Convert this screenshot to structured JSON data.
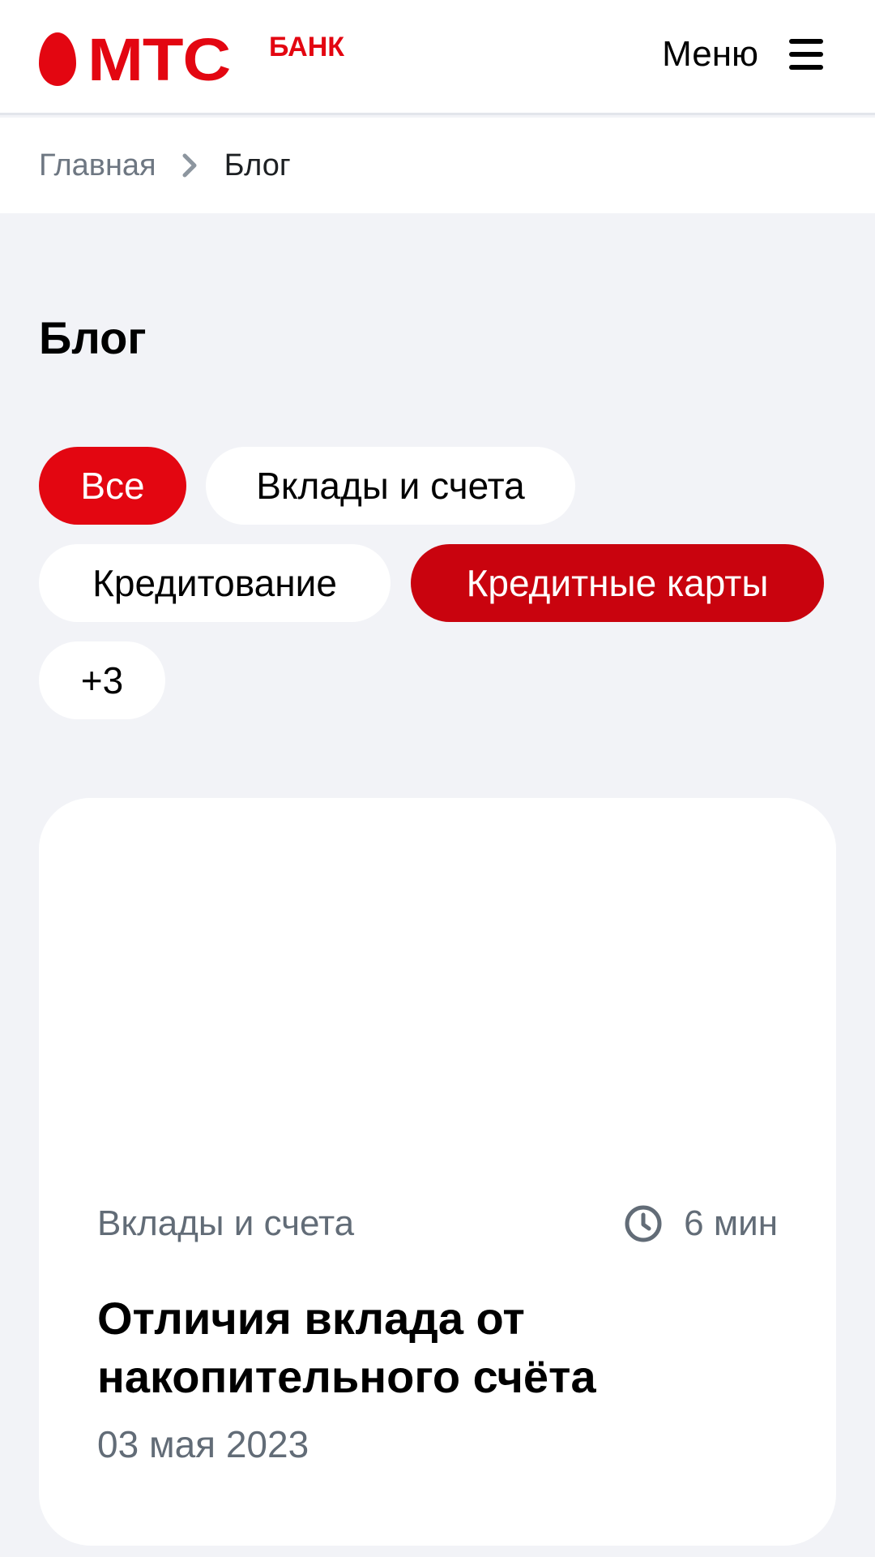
{
  "header": {
    "logo_text": "МТС",
    "logo_sub": "БАНК",
    "menu_label": "Меню",
    "menu_icon": "hamburger-icon",
    "brand_color": "#E30611"
  },
  "breadcrumb": {
    "home": "Главная",
    "separator_icon": "chevron-right-icon",
    "current": "Блог"
  },
  "page": {
    "title": "Блог"
  },
  "filters": {
    "chips": [
      {
        "label": "Все",
        "active": true,
        "color": "#E30611"
      },
      {
        "label": "Вклады и счета",
        "active": false
      },
      {
        "label": "Кредитование",
        "active": false
      },
      {
        "label": "Кредитные карты",
        "active": true,
        "color": "#C9030E"
      },
      {
        "label": "+3",
        "active": false
      }
    ]
  },
  "article": {
    "category": "Вклады и счета",
    "read_time": "6 мин",
    "time_icon": "clock-icon",
    "title": "Отличия вклада от накопительного счёта",
    "date": "03 мая 2023"
  }
}
